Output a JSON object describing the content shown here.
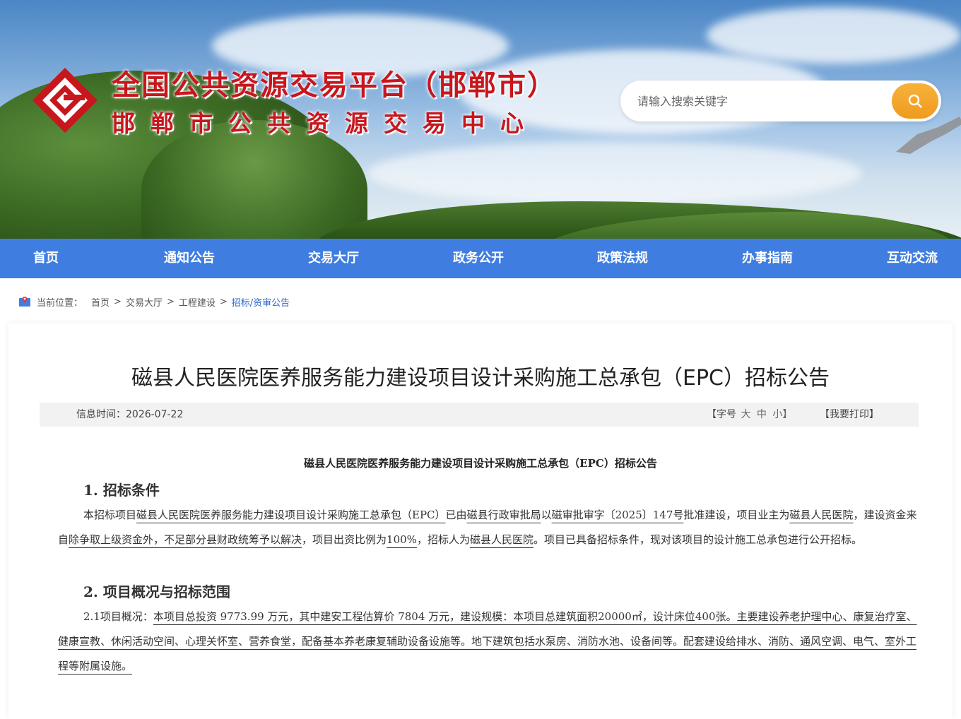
{
  "header": {
    "title_main": "全国公共资源交易平台（邯郸市）",
    "title_sub": "邯郸市公共资源交易中心",
    "search_placeholder": "请输入搜索关键字"
  },
  "nav": {
    "items": [
      "首页",
      "通知公告",
      "交易大厅",
      "政务公开",
      "政策法规",
      "办事指南",
      "互动交流"
    ]
  },
  "breadcrumb": {
    "label": "当前位置：",
    "items": [
      "首页",
      "交易大厅",
      "工程建设"
    ],
    "current": "招标/资审公告",
    "sep": ">"
  },
  "article": {
    "title": "磁县人民医院医养服务能力建设项目设计采购施工总承包（EPC）招标公告",
    "date_label": "信息时间：",
    "date": "2026-07-22",
    "font_label_open": "【字号",
    "font_large": "大",
    "font_medium": "中",
    "font_small": "小】",
    "print": "【我要打印】",
    "doc_title": "磁县人民医院医养服务能力建设项目设计采购施工总承包（EPC）招标公告",
    "section1_heading": "1. 招标条件",
    "section1": {
      "t1": "本招标项目",
      "project": "磁县人民医院医养服务能力建设项目设计采购施工总承包（EPC）",
      "t2": "已由",
      "approver": "磁县行政审批局",
      "t3": "以",
      "approval_no": "磁审批审字〔2025〕147号",
      "t4": "批准建设，项目业主为",
      "owner": "磁县人民医院",
      "t5": "，建设资金来自",
      "funds": "除争取上级资金外，不足部分县财政统筹予以解决",
      "t6": "，项目出资比例为",
      "ratio": "100%",
      "t7": "，招标人为",
      "tenderer": "磁县人民医院",
      "t8": "。项目已具备招标条件，现对该项目的设计施工总承包进行公开招标。"
    },
    "section2_heading": "2. 项目概况与招标范围",
    "section2": {
      "lead": "2.1项目概况：",
      "body": "本项目总投资 9773.99 万元，其中建安工程估算价 7804 万元，建设规模：本项目总建筑面积20000㎡，设计床位400张。主要建设养老护理中心、康复治疗室、健康宣教、休闲活动空间、心理关怀室、营养食堂，配备基本养老康复辅助设备设施等。地下建筑包括水泵房、消防水池、设备间等。配套建设给排水、消防、通风空调、电气、室外工程等附属设施。"
    }
  },
  "colors": {
    "brand_red": "#c8161d",
    "nav_blue": "#3f7ee0",
    "search_orange": "#f09a1f",
    "breadcrumb_current": "#2a62c9"
  },
  "icons": {
    "logo": "exchange-logo-icon",
    "search": "search-icon",
    "location": "location-icon"
  }
}
